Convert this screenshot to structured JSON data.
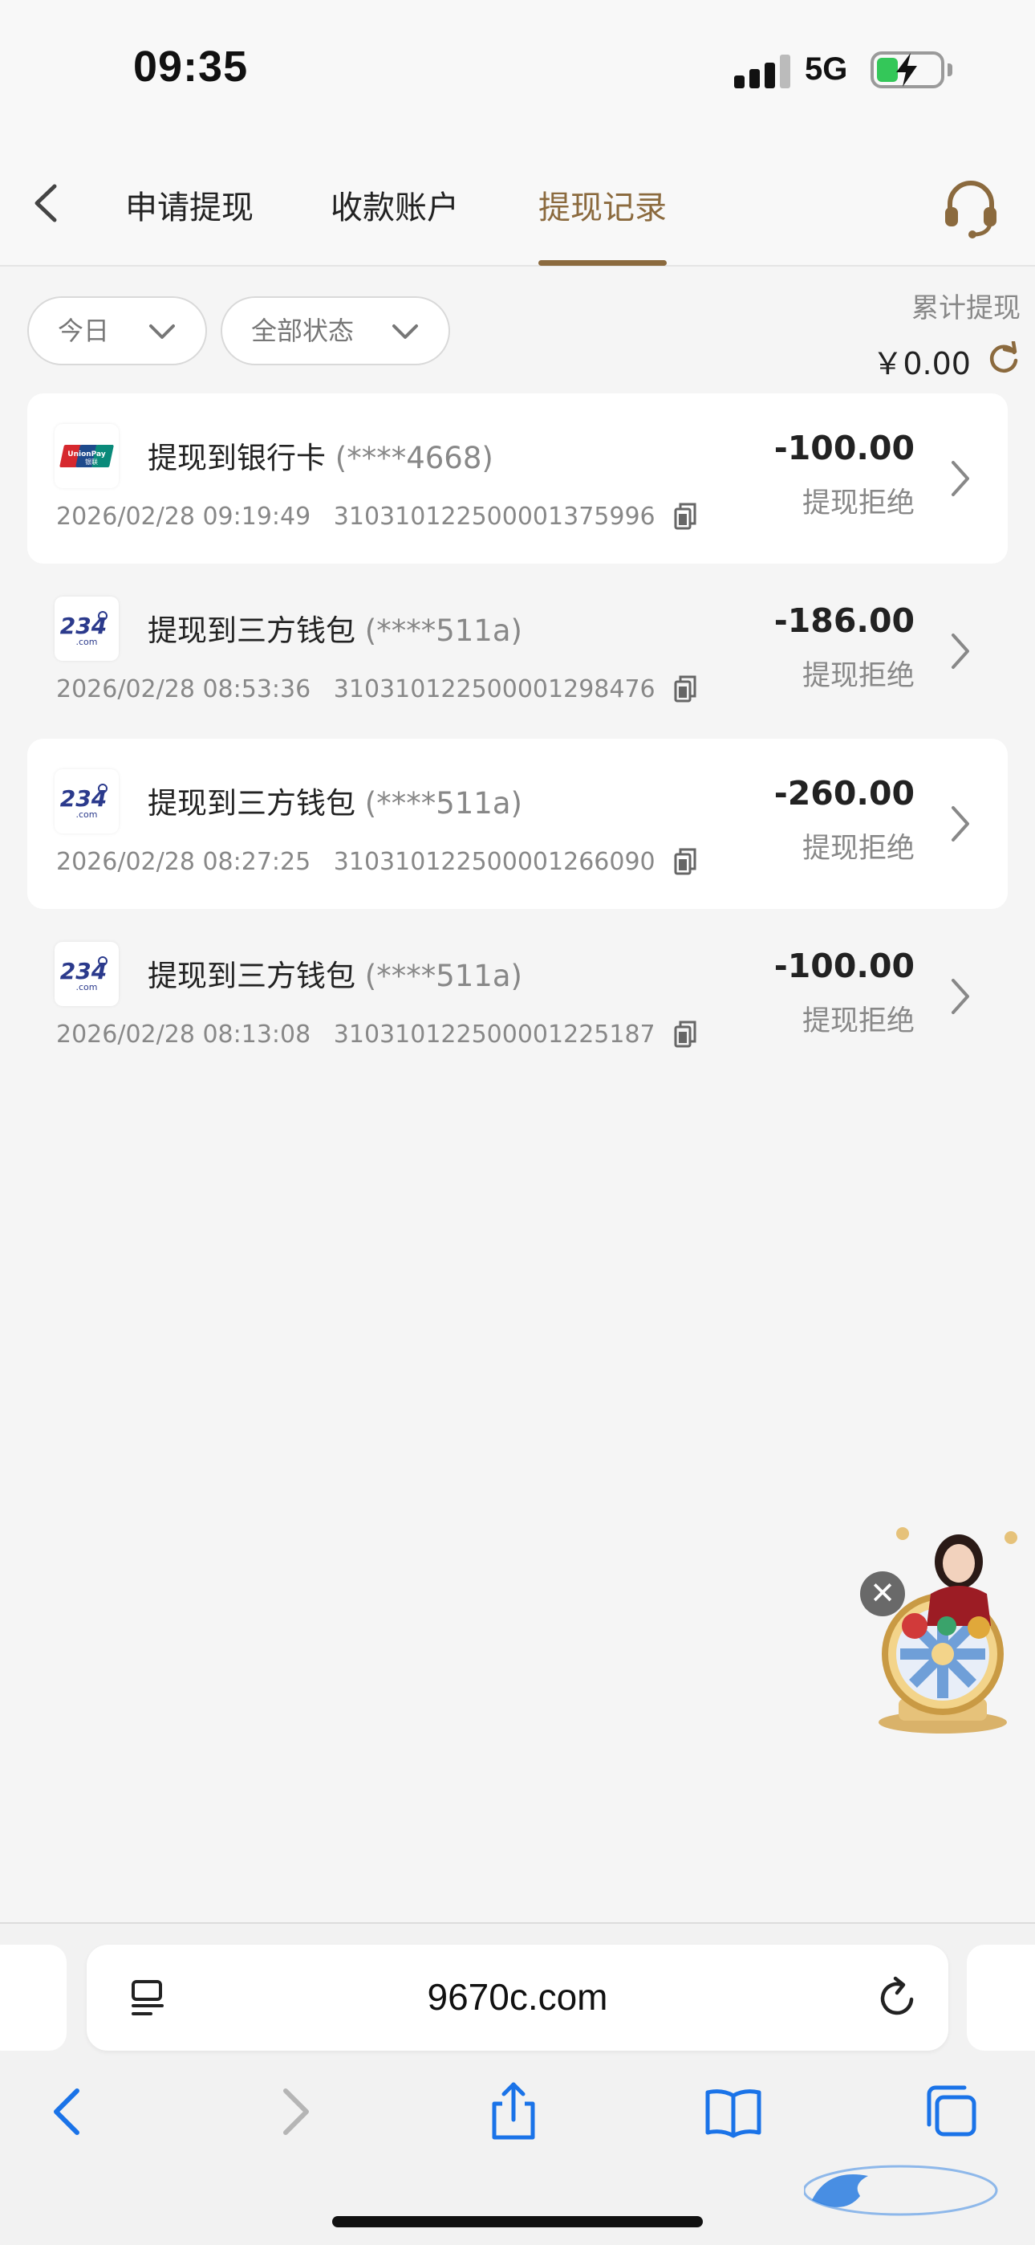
{
  "status_bar": {
    "time": "09:35",
    "network": "5G"
  },
  "tabs": [
    {
      "label": "申请提现"
    },
    {
      "label": "收款账户"
    },
    {
      "label": "提现记录"
    }
  ],
  "filters": {
    "date": "今日",
    "status": "全部状态"
  },
  "summary": {
    "label": "累计提现",
    "value": "￥0.00"
  },
  "records": [
    {
      "title": "提现到银行卡",
      "account": " (****4668)",
      "datetime": "2026/02/28 09:19:49",
      "order_no": "31031012250000137599​6",
      "amount": "-100.00",
      "status": "提现拒绝",
      "logo": "unionpay-icon"
    },
    {
      "title": "提现到三方钱包",
      "account": " (****511a)",
      "datetime": "2026/02/28 08:53:36",
      "order_no": "310310122500001298476",
      "amount": "-186.00",
      "status": "提现拒绝",
      "logo": "234-wallet-icon"
    },
    {
      "title": "提现到三方钱包",
      "account": " (****511a)",
      "datetime": "2026/02/28 08:27:25",
      "order_no": "310310122500001266090",
      "amount": "-260.00",
      "status": "提现拒绝",
      "logo": "234-wallet-icon"
    },
    {
      "title": "提现到三方钱包",
      "account": " (****511a)",
      "datetime": "2026/02/28 08:13:08",
      "order_no": "310310122500001225187",
      "amount": "-100.00",
      "status": "提现拒绝",
      "logo": "234-wallet-icon"
    }
  ],
  "browser": {
    "url": "9670c.com"
  },
  "colors": {
    "accent": "#8b6a3e",
    "background": "#f5f5f5",
    "card": "#ffffff",
    "muted": "#888888"
  }
}
